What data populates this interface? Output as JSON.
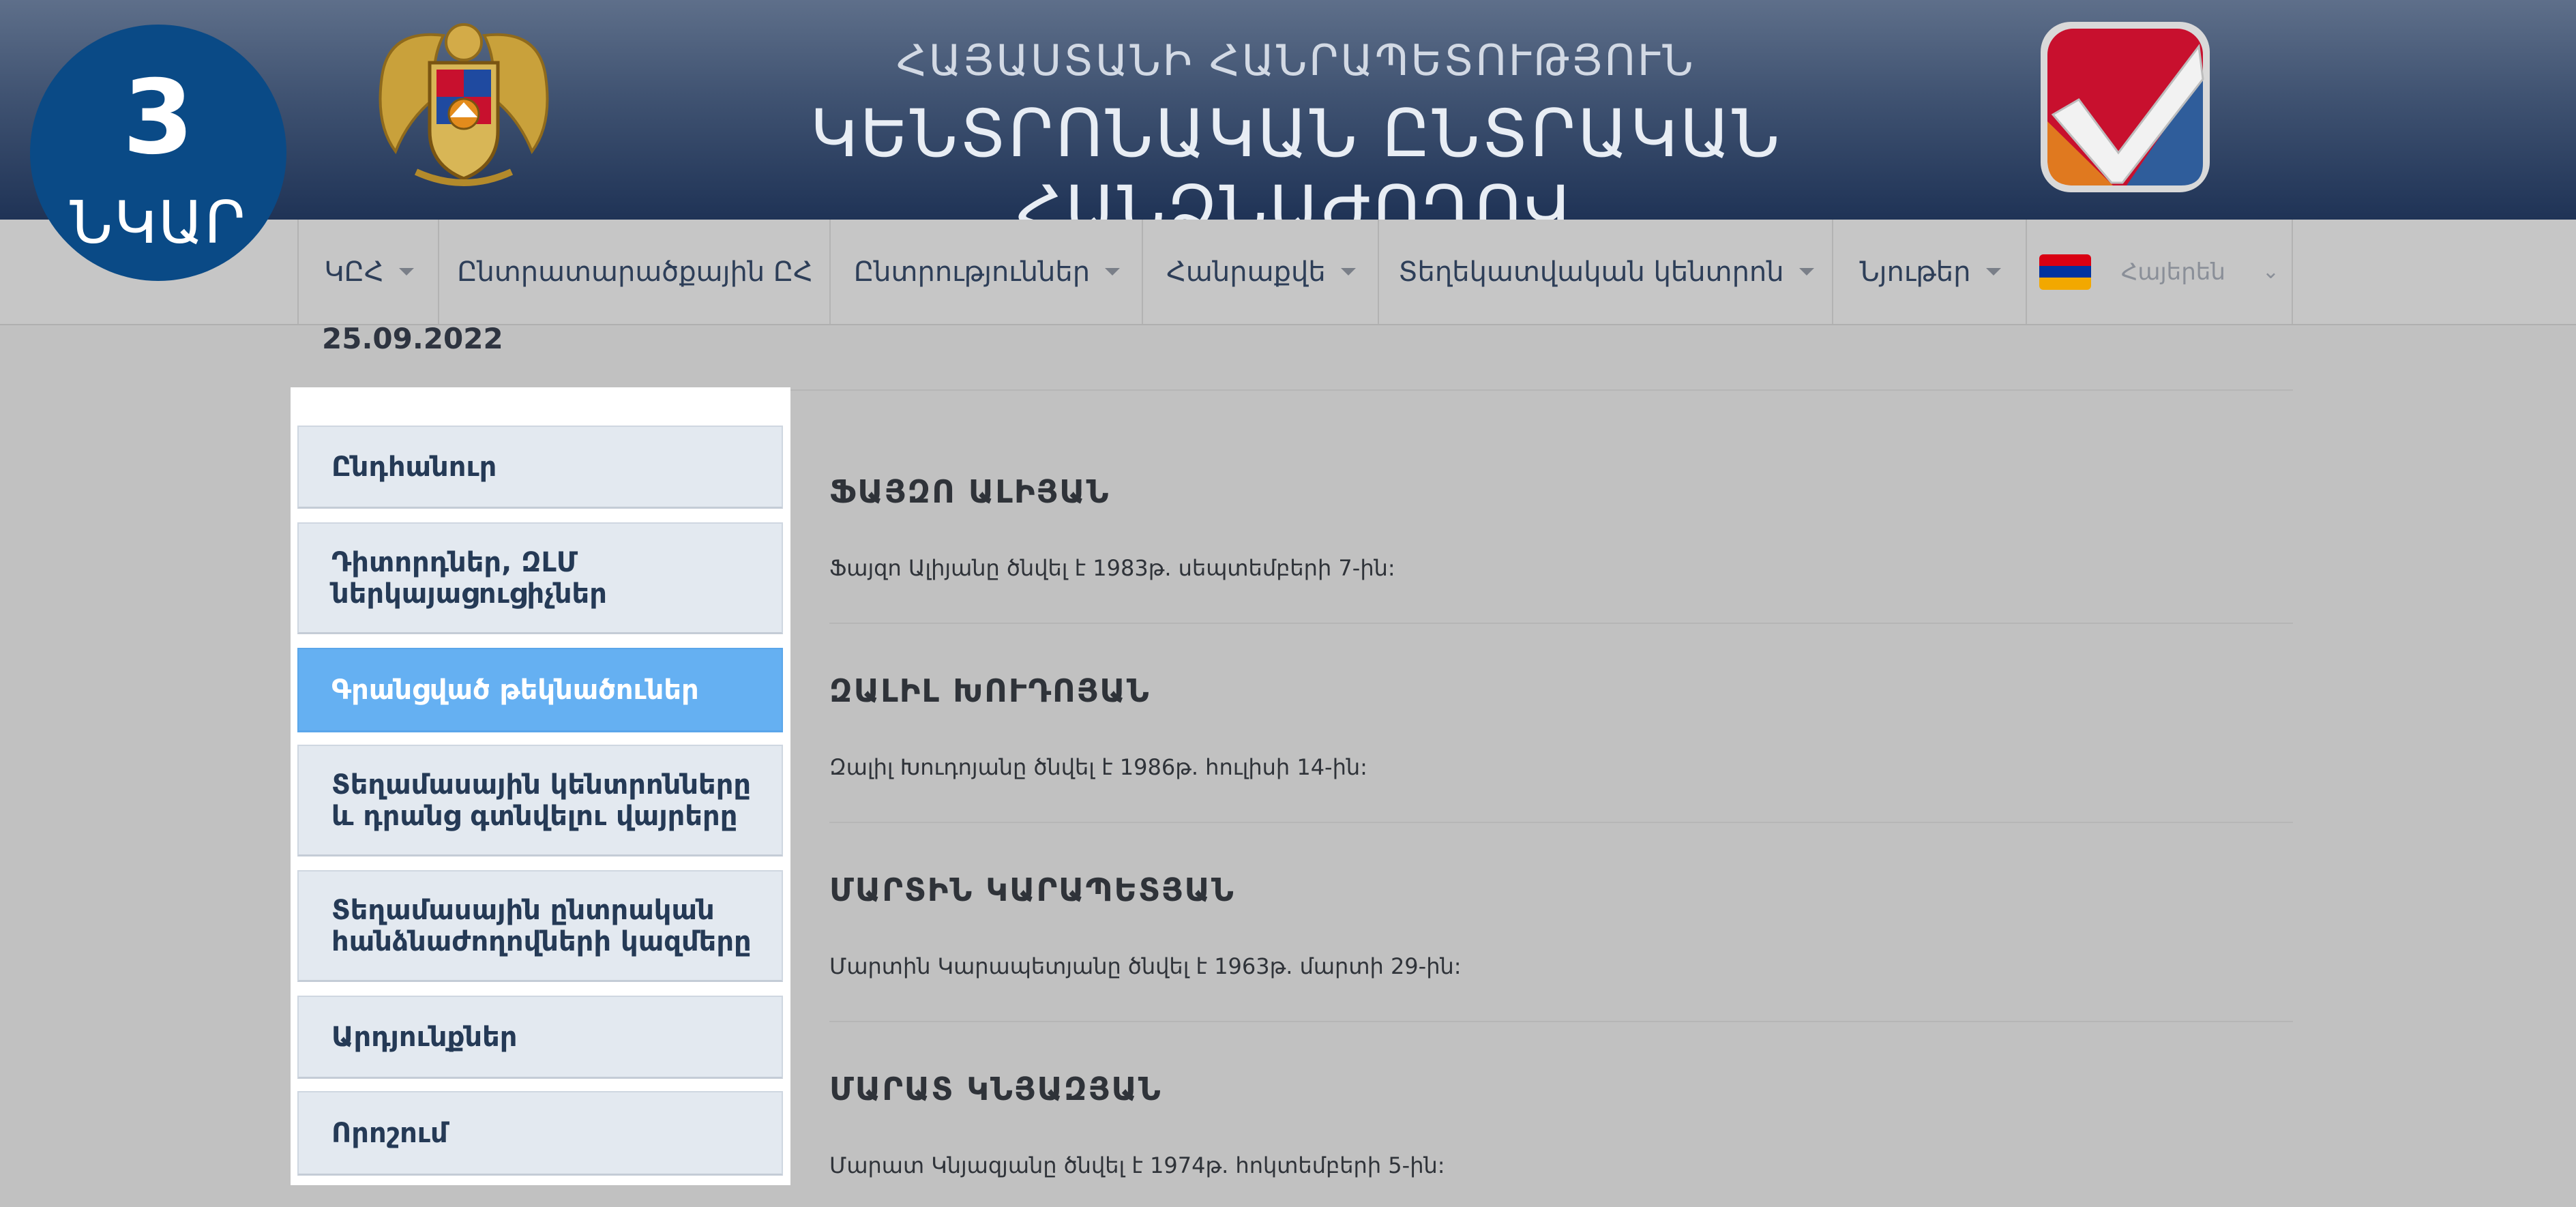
{
  "badge": {
    "number": "3",
    "word": "ՆԿԱՐ"
  },
  "header": {
    "title_top": "ՀԱՅԱՍՏԱՆԻ ՀԱՆՐԱՊԵՏՈՒԹՅՈՒՆ",
    "title_main": "ԿԵՆՏՐՈՆԱԿԱՆ ԸՆՏՐԱԿԱՆ ՀԱՆՁՆԱԺՈՂՈՎ"
  },
  "nav": {
    "items": [
      {
        "label": "ԿԸՀ",
        "dropdown": true
      },
      {
        "label": "Ընտրատարածքային ԸՀ",
        "dropdown": false
      },
      {
        "label": "Ընտրություններ",
        "dropdown": true
      },
      {
        "label": "Հանրաքվե",
        "dropdown": true
      },
      {
        "label": "Տեղեկատվական կենտրոն",
        "dropdown": true
      },
      {
        "label": "Նյութեր",
        "dropdown": true
      }
    ],
    "language": "Հայերեն"
  },
  "date": "25.09.2022",
  "sidebar": {
    "items": [
      {
        "label": "Ընդհանուր"
      },
      {
        "label": "Դիտորդներ, ԶԼՄ ներկայացուցիչներ"
      },
      {
        "label": "Գրանցված թեկնածուներ",
        "active": true
      },
      {
        "label": "Տեղամասային կենտրոնները և դրանց գտնվելու վայրերը"
      },
      {
        "label": "Տեղամասային ընտրական հանձնաժողովների կազմերը"
      },
      {
        "label": "Արդյունքներ"
      },
      {
        "label": "Որոշում"
      }
    ]
  },
  "candidates": [
    {
      "name": "ՖԱՅԶՈ ԱԼԻՅԱՆ",
      "bio": "Ֆայզո Ալիյանը ծնվել է 1983թ. սեպտեմբերի 7-ին:"
    },
    {
      "name": "ԶԱԼԻԼ ԽՈՒԴՈՅԱՆ",
      "bio": "Զալիլ Խուդոյանը ծնվել է 1986թ. հուլիսի 14-ին:"
    },
    {
      "name": "ՄԱՐՏԻՆ ԿԱՐԱՊԵՏՅԱՆ",
      "bio": "Մարտին Կարապետյանը ծնվել է 1963թ. մարտի 29-ին:"
    },
    {
      "name": "ՄԱՐԱՏ ԿՆՅԱԶՅԱՆ",
      "bio": "Մարատ Կնյազյանը ծնվել է 1974թ. հոկտեմբերի 5-ին:"
    }
  ],
  "icons": {
    "coat_of_arms": "armenia-coat-of-arms-icon",
    "logo": "checkmark-logo-icon",
    "flag": "armenia-flag-icon",
    "dropdown": "caret-down-icon"
  },
  "colors": {
    "header_dark": "#1f3356",
    "badge": "#0a4a86",
    "active_item": "#65b0f2",
    "logo_red": "#c8102e",
    "logo_blue": "#2f5d9b",
    "logo_orange": "#e0791f"
  }
}
